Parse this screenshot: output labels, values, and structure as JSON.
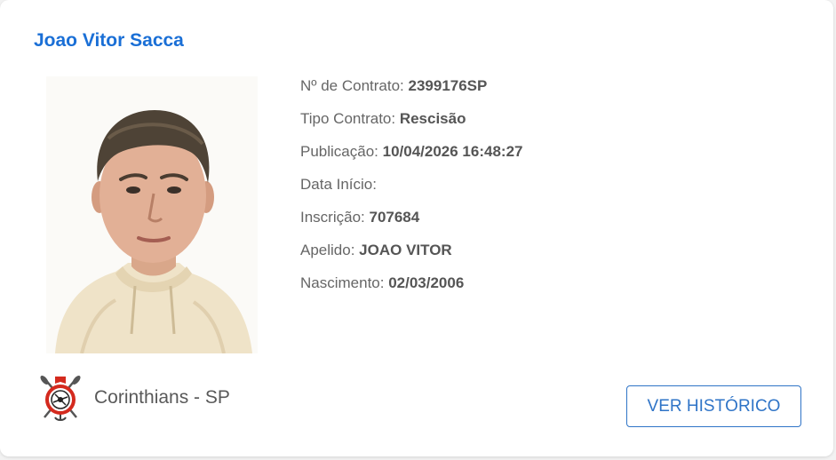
{
  "player": {
    "name": "Joao Vitor Sacca"
  },
  "details": [
    {
      "label": "Nº de Contrato: ",
      "value": "2399176SP"
    },
    {
      "label": "Tipo Contrato: ",
      "value": "Rescisão"
    },
    {
      "label": "Publicação: ",
      "value": "10/04/2026 16:48:27"
    },
    {
      "label": "Data Início:",
      "value": ""
    },
    {
      "label": "Inscrição: ",
      "value": "707684"
    },
    {
      "label": "Apelido: ",
      "value": "JOAO VITOR"
    },
    {
      "label": "Nascimento: ",
      "value": "02/03/2006"
    }
  ],
  "club": {
    "name": "Corinthians - SP",
    "logo_icon": "corinthians-crest-icon"
  },
  "actions": {
    "history_label": "VER HISTÓRICO"
  },
  "colors": {
    "name": "#1a6fd6",
    "button": "#2f74c7",
    "crest_red": "#d42a1e"
  }
}
